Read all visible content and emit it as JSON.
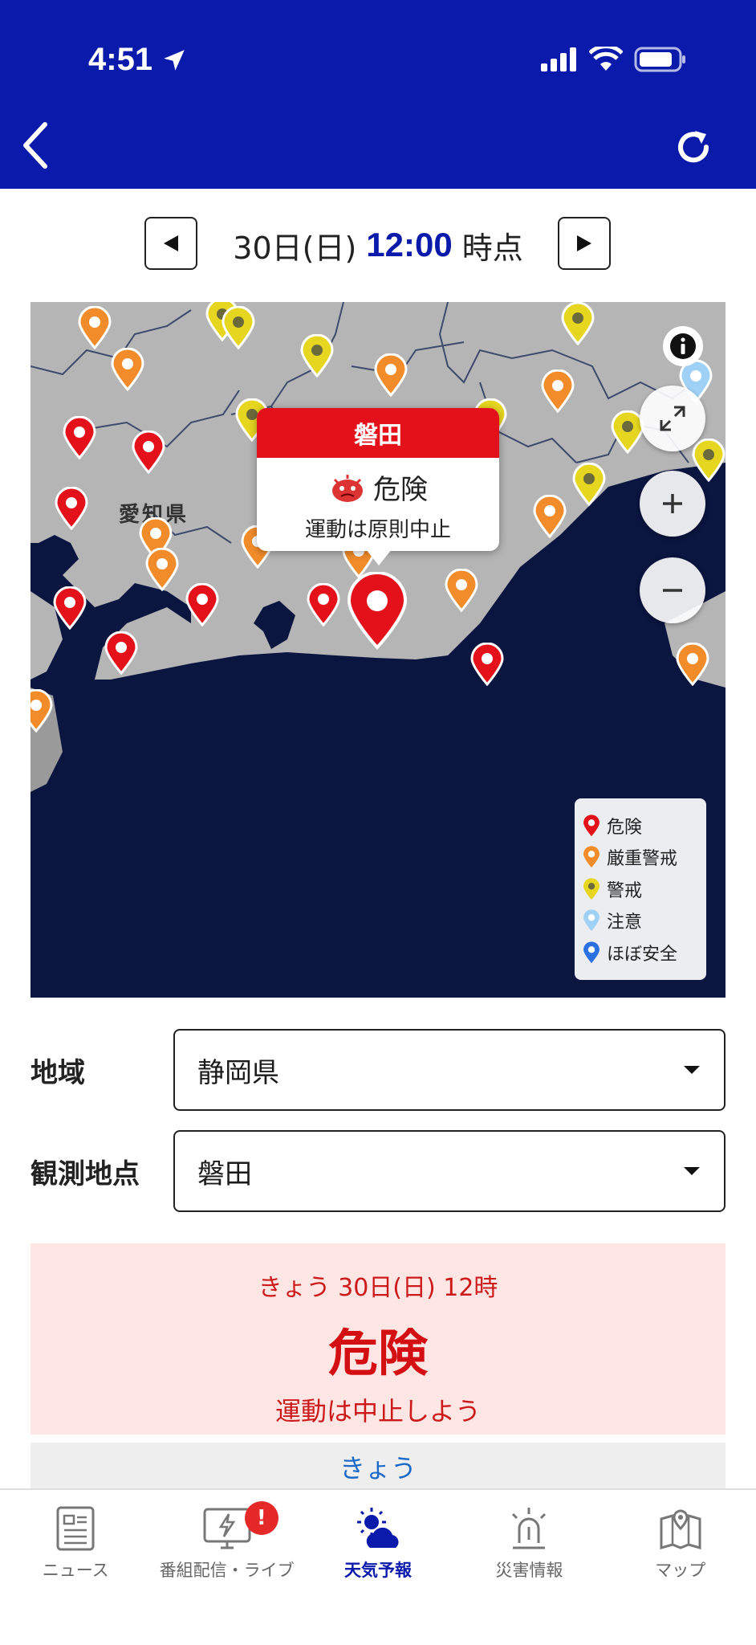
{
  "status": {
    "time": "4:51"
  },
  "datebar": {
    "date": "30日(日)",
    "time": "12:00",
    "suffix": "時点"
  },
  "map": {
    "prefecture_label": "愛知県",
    "popup": {
      "station": "磐田",
      "level": "危険",
      "message": "運動は原則中止"
    },
    "legend": [
      {
        "label": "危険",
        "color": "#e4101a"
      },
      {
        "label": "厳重警戒",
        "color": "#f28c2a"
      },
      {
        "label": "警戒",
        "color": "#e6d620"
      },
      {
        "label": "注意",
        "color": "#9fd0f5"
      },
      {
        "label": "ほぼ安全",
        "color": "#2a70e0"
      }
    ]
  },
  "region": {
    "label": "地域",
    "value": "静岡県"
  },
  "station": {
    "label": "観測地点",
    "value": "磐田"
  },
  "result": {
    "date": "きょう 30日(日) 12時",
    "level": "危険",
    "message": "運動は中止しよう"
  },
  "today_tab": "きょう",
  "nav": {
    "items": [
      {
        "label": "ニュース"
      },
      {
        "label": "番組配信・ライブ",
        "badge": "!"
      },
      {
        "label": "天気予報"
      },
      {
        "label": "災害情報"
      },
      {
        "label": "マップ"
      }
    ]
  }
}
